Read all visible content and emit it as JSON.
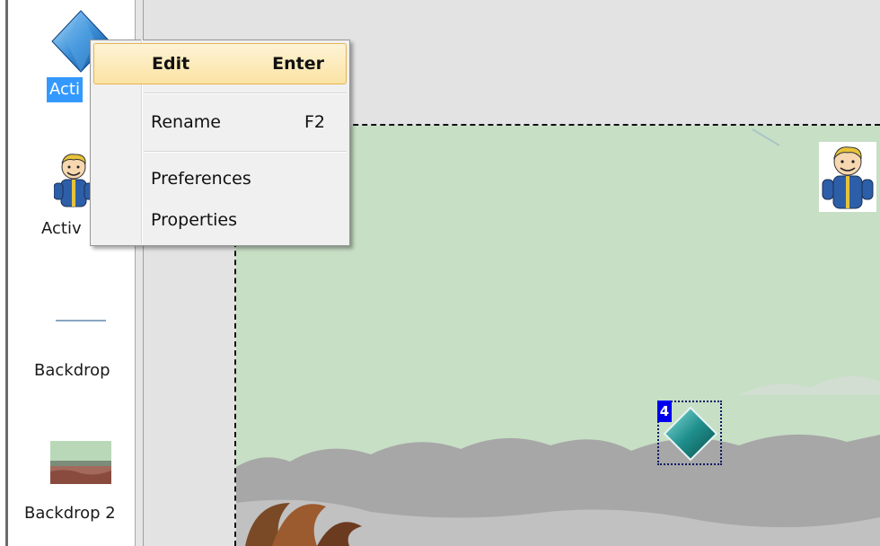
{
  "objects_panel": {
    "items": [
      {
        "label": "Acti",
        "icon": "diamond-active-icon",
        "selected": true
      },
      {
        "label": "Activ",
        "icon": "vault-boy-icon"
      },
      {
        "label": "Backdrop",
        "icon": "backdrop-line-icon"
      },
      {
        "label": "Backdrop 2",
        "icon": "landscape-thumbnail-icon"
      }
    ]
  },
  "context_menu": {
    "items": [
      {
        "label": "Edit",
        "shortcut": "Enter",
        "highlighted": true
      },
      {
        "label": "Rename",
        "shortcut": "F2"
      },
      {
        "label": "Preferences",
        "shortcut": ""
      },
      {
        "label": "Properties",
        "shortcut": ""
      }
    ]
  },
  "frame": {
    "selected_object_number": "4",
    "background_color": "#c7dfc5"
  },
  "colors": {
    "selection": "#3399ff",
    "menu_highlight": "#fbe3a3",
    "ground": "#a7a7a7"
  }
}
